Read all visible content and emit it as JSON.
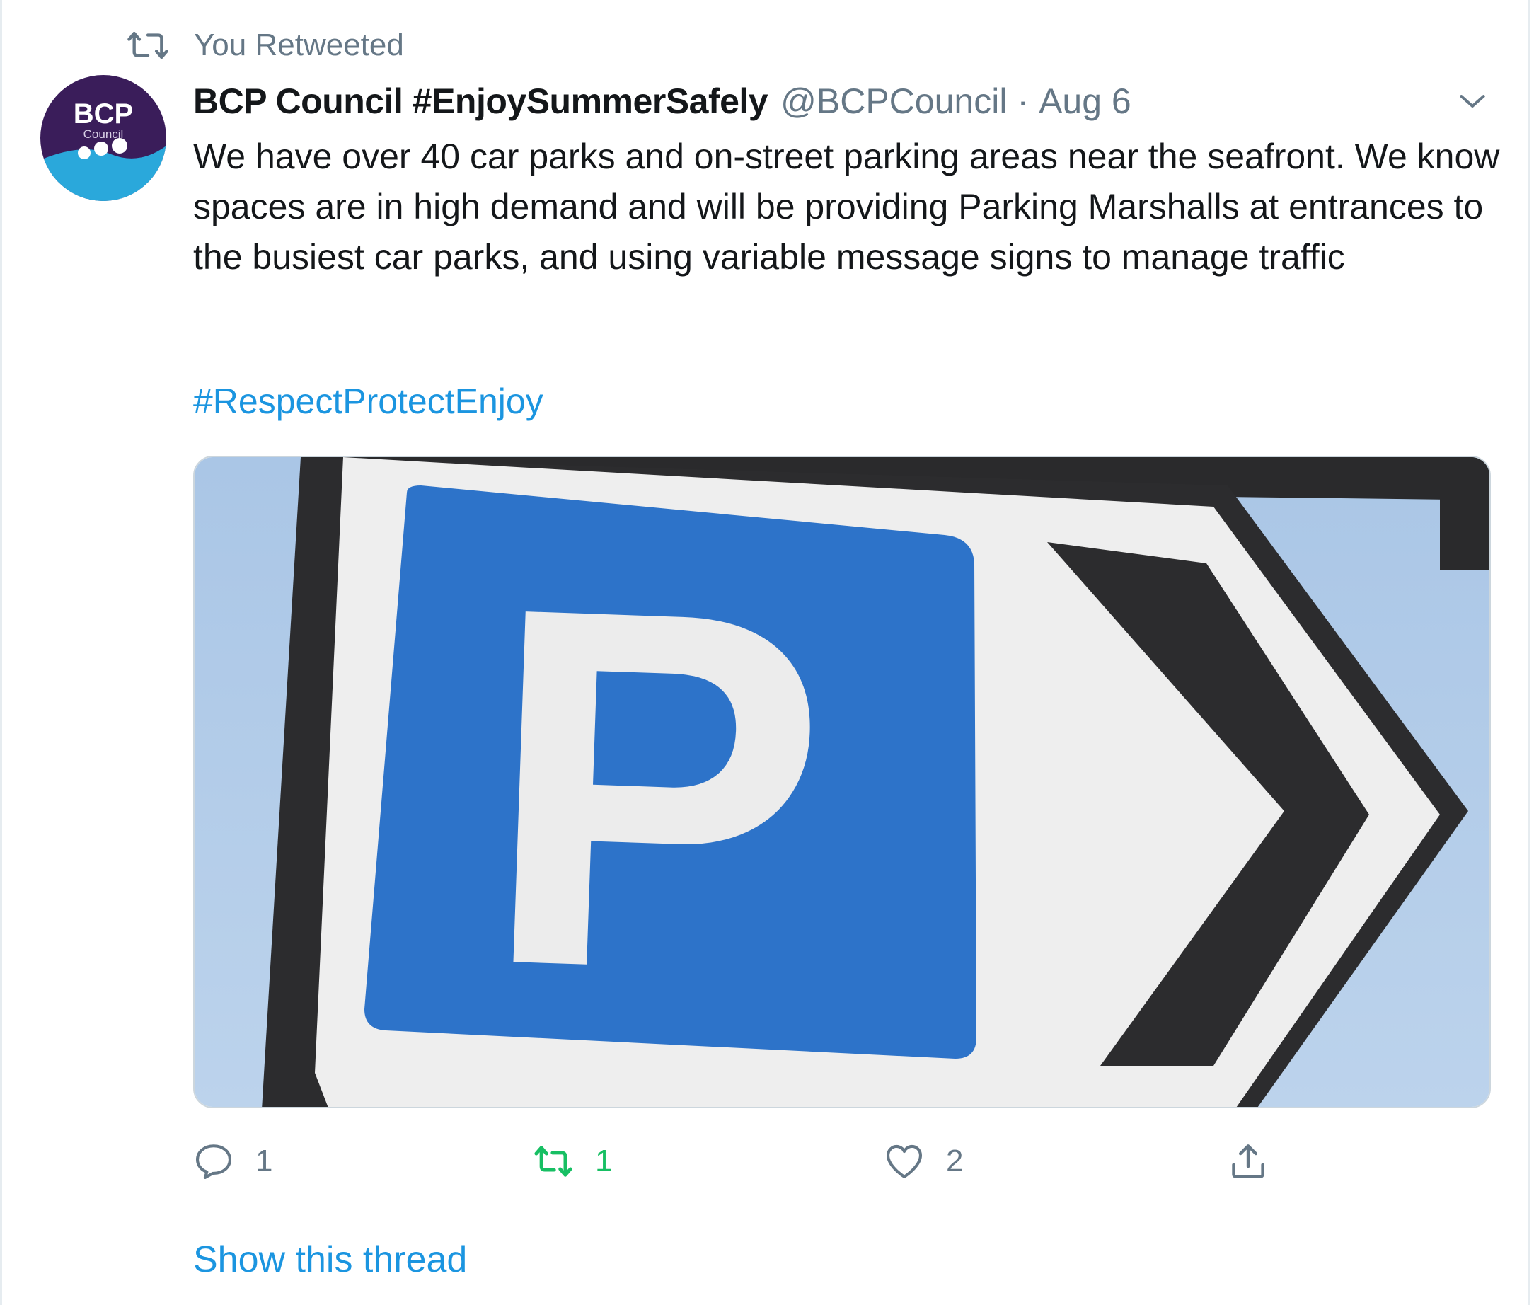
{
  "retweet_context": {
    "label": "You Retweeted",
    "icon": "retweet-icon"
  },
  "avatar": {
    "logo_text": "BCP",
    "logo_subtext": "Council"
  },
  "tweet": {
    "display_name": "BCP Council #EnjoySummerSafely",
    "handle": "@BCPCouncil",
    "separator": "·",
    "date": "Aug 6",
    "text": "We have over 40 car parks and on-street parking areas near the seafront. We know spaces are in high demand and will be providing Parking Marshalls at entrances to the busiest car parks, and using variable message signs to manage traffic",
    "hashtag": "#RespectProtectEnjoy"
  },
  "media": {
    "sign_letter": "P"
  },
  "actions": {
    "reply_count": "1",
    "retweet_count": "1",
    "like_count": "2"
  },
  "show_thread": "Show this thread",
  "colors": {
    "link": "#1b95e0",
    "retweet_active": "#17bf63",
    "muted": "#657786",
    "text": "#14171a",
    "sign_blue": "#2d73c9",
    "avatar_purple": "#3a1d5a",
    "avatar_cyan": "#2aa8db"
  }
}
